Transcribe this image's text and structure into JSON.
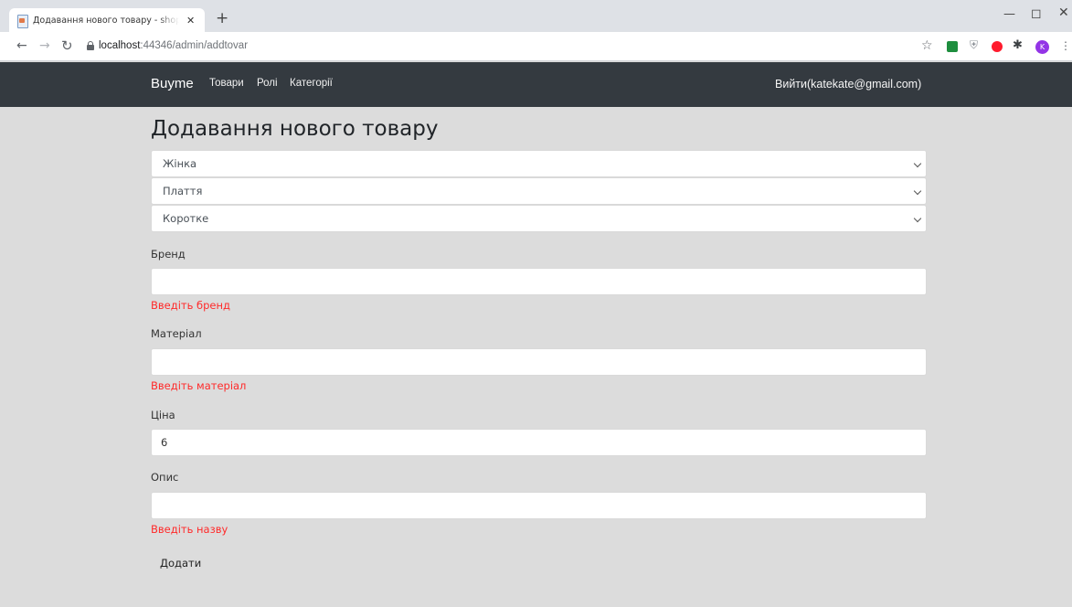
{
  "browser": {
    "tab_title": "Додавання нового товару - shop",
    "tab_close": "✕",
    "new_tab": "+",
    "url_host": "localhost",
    "url_path": ":44346/admin/addtovar",
    "avatar_letter": "K",
    "icons": {
      "back": "back-arrow-icon",
      "forward": "forward-arrow-icon",
      "reload": "reload-icon",
      "lock": "lock-icon",
      "star": "star-icon",
      "extensions": "puzzle-icon",
      "menu": "kebab-menu-icon"
    },
    "colors": {
      "avatar": "#9334e6",
      "ext_green": "#1e8e3e",
      "ext_opera": "#ff1b2d"
    }
  },
  "navbar": {
    "brand": "Buyme",
    "links": [
      "Товари",
      "Ролі",
      "Категорії"
    ],
    "logout": "Вийти(katekate@gmail.com)",
    "background": "#343a40"
  },
  "form": {
    "title": "Додавання нового товару",
    "selects": [
      {
        "value": "Жінка"
      },
      {
        "value": "Плаття"
      },
      {
        "value": "Коротке"
      }
    ],
    "fields": [
      {
        "label": "Бренд",
        "value": "",
        "error": "Введіть бренд"
      },
      {
        "label": "Матеріал",
        "value": "",
        "error": "Введіть матеріал"
      },
      {
        "label": "Ціна",
        "value": "6",
        "error": ""
      },
      {
        "label": "Опис",
        "value": "",
        "error": "Введіть назву"
      }
    ],
    "submit_label": "Додати",
    "error_color": "#ff2a2a"
  }
}
